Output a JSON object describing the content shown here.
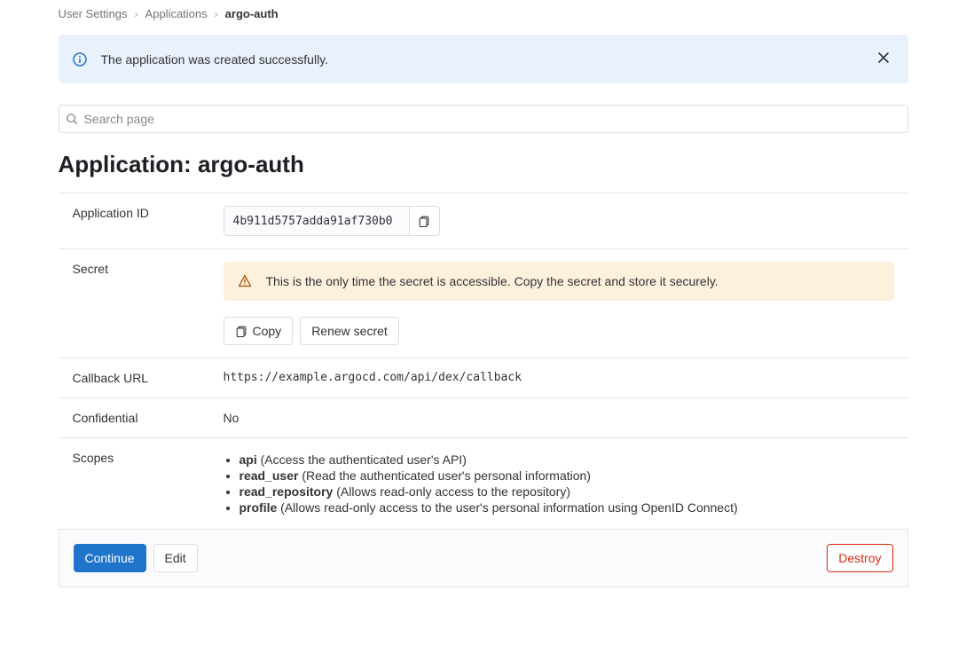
{
  "breadcrumb": {
    "root": "User Settings",
    "section": "Applications",
    "current": "argo-auth"
  },
  "flash": {
    "message": "The application was created successfully."
  },
  "search": {
    "placeholder": "Search page"
  },
  "page": {
    "title_prefix": "Application: ",
    "app_name": "argo-auth"
  },
  "rows": {
    "application_id": {
      "label": "Application ID",
      "value": "4b911d5757adda91af730b0"
    },
    "secret": {
      "label": "Secret",
      "warning": "This is the only time the secret is accessible. Copy the secret and store it securely.",
      "copy": "Copy",
      "renew": "Renew secret"
    },
    "callback": {
      "label": "Callback URL",
      "value": "https://example.argocd.com/api/dex/callback"
    },
    "confidential": {
      "label": "Confidential",
      "value": "No"
    },
    "scopes": {
      "label": "Scopes",
      "items": [
        {
          "name": "api",
          "desc": "(Access the authenticated user's API)"
        },
        {
          "name": "read_user",
          "desc": "(Read the authenticated user's personal information)"
        },
        {
          "name": "read_repository",
          "desc": "(Allows read-only access to the repository)"
        },
        {
          "name": "profile",
          "desc": "(Allows read-only access to the user's personal information using OpenID Connect)"
        }
      ]
    }
  },
  "footer": {
    "continue": "Continue",
    "edit": "Edit",
    "destroy": "Destroy"
  }
}
